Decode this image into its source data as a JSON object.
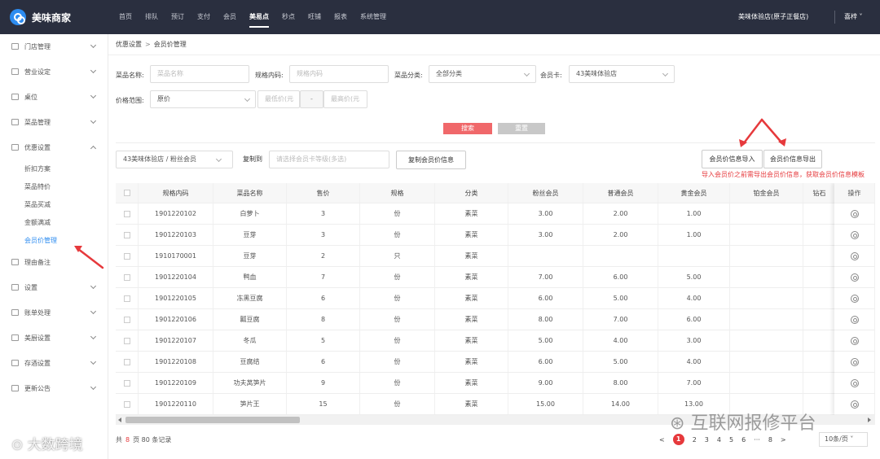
{
  "app": {
    "title": "美味商家"
  },
  "nav": [
    "首页",
    "排队",
    "预订",
    "支付",
    "会员",
    "美易点",
    "秒点",
    "旺铺",
    "报表",
    "系统管理"
  ],
  "nav_active": "美易点",
  "store_name": "美味体验店(原子正餐店)",
  "user_name": "喜梓",
  "sidebar": {
    "items": [
      "门店管理",
      "营业设定",
      "桌位",
      "菜品管理",
      "优惠设置",
      "理由备注",
      "设置",
      "账单处理",
      "美厨设置",
      "存酒设置",
      "更新公告"
    ],
    "subitems": [
      "折扣方案",
      "菜品特价",
      "菜品买减",
      "金额满减",
      "会员价管理"
    ],
    "active_sub": "会员价管理"
  },
  "breadcrumb": {
    "parent": "优惠设置",
    "sep": ">",
    "current": "会员价管理"
  },
  "filters": {
    "dish_name_label": "菜品名称:",
    "dish_name_placeholder": "菜品名称",
    "spec_label": "规格内码:",
    "spec_placeholder": "规格内码",
    "category_label": "菜品分类:",
    "category_value": "全部分类",
    "card_label": "会员卡:",
    "card_value": "43美味体验店",
    "price_label": "价格范围:",
    "price_type": "原价",
    "min_placeholder": "最低价(元",
    "range_sep": "-",
    "max_placeholder": "最高价(元"
  },
  "buttons": {
    "search": "搜索",
    "reset": "重置",
    "copy_price": "复制会员价信息",
    "import": "会员价信息导入",
    "export": "会员价信息导出"
  },
  "copy_bar": {
    "source": "43美味体验店 / 粉丝会员",
    "label": "复制到",
    "target_placeholder": "请选择会员卡等级(多选)"
  },
  "tip": "导入会员价之前需导出会员价信息，获取会员价信息模板",
  "table": {
    "headers": [
      "规格内码",
      "菜品名称",
      "售价",
      "规格",
      "分类",
      "粉丝会员",
      "普通会员",
      "黄金会员",
      "铂金会员",
      "钻石",
      "操作"
    ],
    "rows": [
      [
        "1901220102",
        "白萝卜",
        "3",
        "份",
        "素菜",
        "3.00",
        "2.00",
        "1.00",
        ""
      ],
      [
        "1901220103",
        "豆芽",
        "3",
        "份",
        "素菜",
        "3.00",
        "2.00",
        "1.00",
        ""
      ],
      [
        "1910170001",
        "豆芽",
        "2",
        "只",
        "素菜",
        "",
        "",
        "",
        ""
      ],
      [
        "1901220104",
        "鸭血",
        "7",
        "份",
        "素菜",
        "7.00",
        "6.00",
        "5.00",
        ""
      ],
      [
        "1901220105",
        "冻黑豆腐",
        "6",
        "份",
        "素菜",
        "6.00",
        "5.00",
        "4.00",
        ""
      ],
      [
        "1901220106",
        "瓤豆腐",
        "8",
        "份",
        "素菜",
        "8.00",
        "7.00",
        "6.00",
        ""
      ],
      [
        "1901220107",
        "冬瓜",
        "5",
        "份",
        "素菜",
        "5.00",
        "4.00",
        "3.00",
        ""
      ],
      [
        "1901220108",
        "豆腐结",
        "6",
        "份",
        "素菜",
        "6.00",
        "5.00",
        "4.00",
        ""
      ],
      [
        "1901220109",
        "功夫莴笋片",
        "9",
        "份",
        "素菜",
        "9.00",
        "8.00",
        "7.00",
        ""
      ],
      [
        "1901220110",
        "笋片王",
        "15",
        "份",
        "素菜",
        "15.00",
        "14.00",
        "13.00",
        ""
      ]
    ]
  },
  "footer": {
    "prefix": "共",
    "pages": "8",
    "suffix": "页 80 条记录"
  },
  "pager": {
    "prev": "<",
    "pages": [
      "1",
      "2",
      "3",
      "4",
      "5",
      "6",
      "···",
      "8"
    ],
    "next": ">",
    "size": "10条/页"
  },
  "watermarks": {
    "left": "大数跨境",
    "right": "互联网报修平台"
  },
  "colors": {
    "topbar": "#2a2f3f",
    "accent": "#2d8cf0",
    "danger": "#e6393c",
    "search": "#f0686a"
  }
}
